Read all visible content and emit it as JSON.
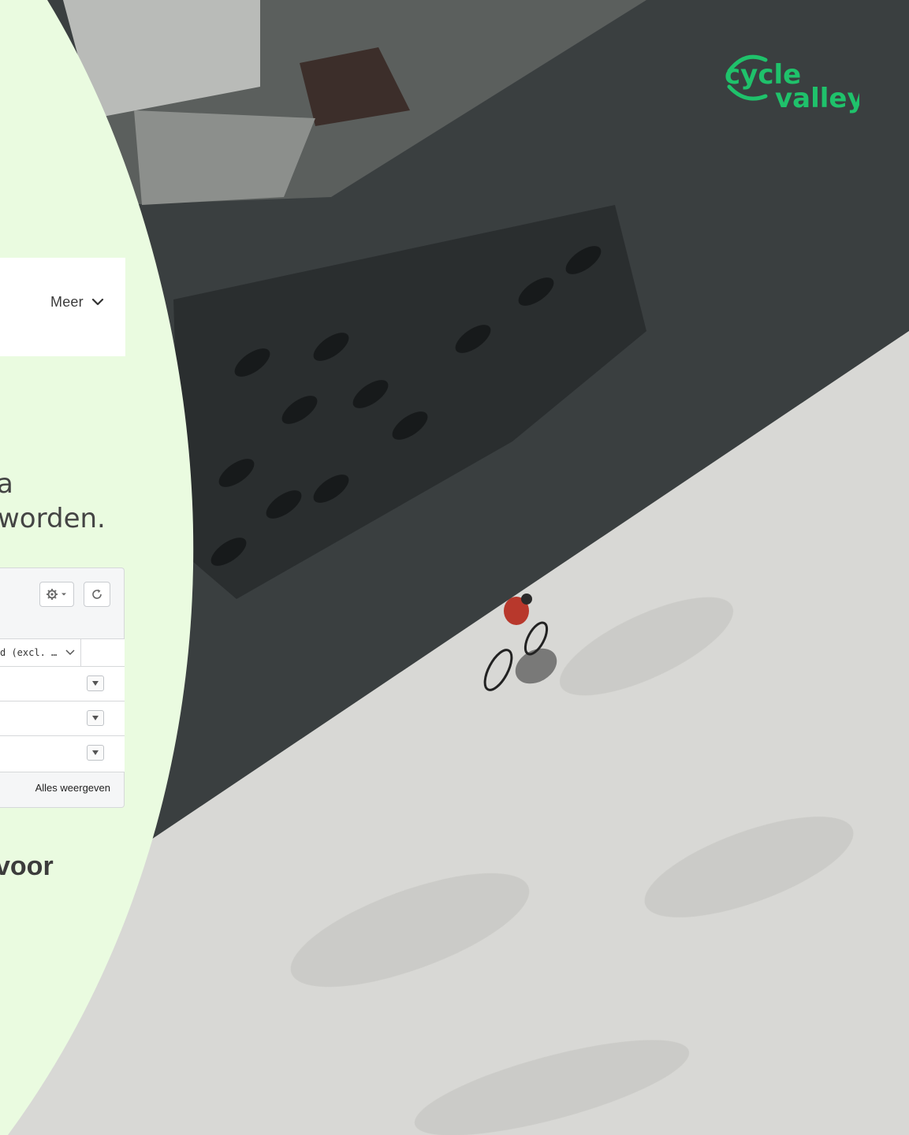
{
  "brand": {
    "logo_line1": "cycle",
    "logo_line2": "valley",
    "accent": "#1fc26b",
    "panel_color": "#eafbe0"
  },
  "nav": {
    "more_label": "Meer"
  },
  "content": {
    "headline_line1": "a",
    "headline_line2": "worden.",
    "subheading": "voor"
  },
  "grid": {
    "column_header": "d (excl. …",
    "rows": 3,
    "show_all_label": "Alles weergeven"
  },
  "icons": {
    "settings": "gear-icon",
    "refresh": "refresh-icon",
    "chevron": "chevron-down-icon",
    "dropdown": "triangle-down-icon"
  }
}
